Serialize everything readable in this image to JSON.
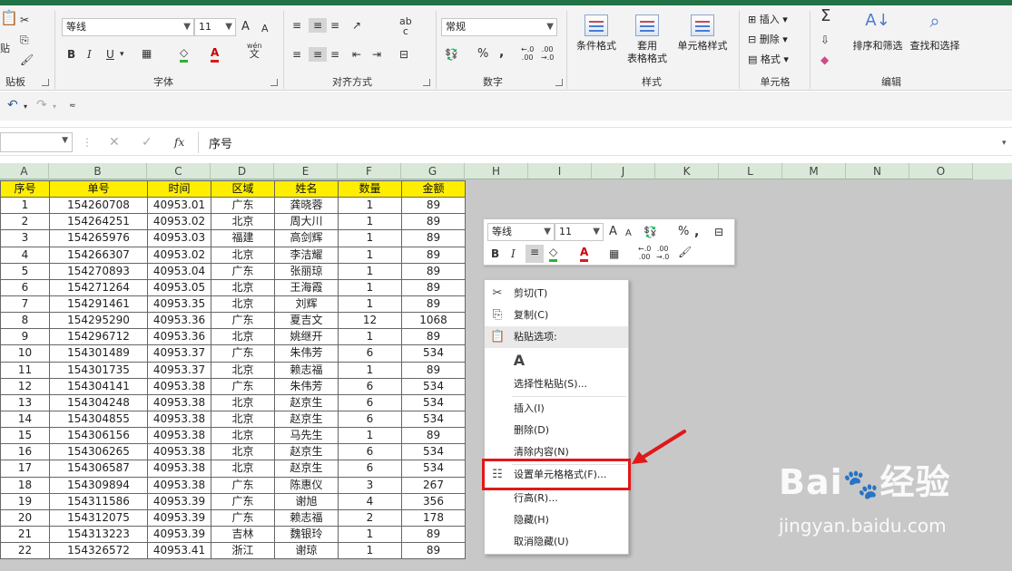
{
  "ribbon": {
    "clipboard": {
      "paste_label": "贴",
      "group_label": "贴板"
    },
    "font": {
      "name": "等线",
      "size": "11",
      "bold": "B",
      "italic": "I",
      "underline": "U",
      "grow": "A",
      "shrink": "A",
      "wen": "wén",
      "wen_char": "文",
      "group_label": "字体"
    },
    "align": {
      "group_label": "对齐方式",
      "wrap": "ab",
      "wrap_char": "c"
    },
    "number": {
      "format": "常规",
      "percent": "%",
      "comma": ",",
      "group_label": "数字"
    },
    "styles": {
      "cond": "条件格式",
      "table_1": "套用",
      "table_2": "表格格式",
      "cell": "单元格样式",
      "group_label": "样式"
    },
    "cells": {
      "insert": "插入",
      "delete": "删除",
      "format": "格式",
      "group_label": "单元格"
    },
    "editing": {
      "sum": "Σ",
      "sort": "排序和筛选",
      "find": "查找和选择",
      "group_label": "编辑"
    }
  },
  "formula_bar": {
    "content": "序号",
    "fx": "fx"
  },
  "columns": [
    "A",
    "B",
    "C",
    "D",
    "E",
    "F",
    "G",
    "H",
    "I",
    "J",
    "K",
    "L",
    "M",
    "N",
    "O"
  ],
  "headers": [
    "序号",
    "单号",
    "时间",
    "区域",
    "姓名",
    "数量",
    "金额"
  ],
  "rows": [
    [
      "1",
      "154260708",
      "40953.01",
      "广东",
      "龚晓蓉",
      "1",
      "89"
    ],
    [
      "2",
      "154264251",
      "40953.02",
      "北京",
      "周大川",
      "1",
      "89"
    ],
    [
      "3",
      "154265976",
      "40953.03",
      "福建",
      "高剑辉",
      "1",
      "89"
    ],
    [
      "4",
      "154266307",
      "40953.02",
      "北京",
      "李洁耀",
      "1",
      "89"
    ],
    [
      "5",
      "154270893",
      "40953.04",
      "广东",
      "张丽琼",
      "1",
      "89"
    ],
    [
      "6",
      "154271264",
      "40953.05",
      "北京",
      "王海霞",
      "1",
      "89"
    ],
    [
      "7",
      "154291461",
      "40953.35",
      "北京",
      "刘辉",
      "1",
      "89"
    ],
    [
      "8",
      "154295290",
      "40953.36",
      "广东",
      "夏吉文",
      "12",
      "1068"
    ],
    [
      "9",
      "154296712",
      "40953.36",
      "北京",
      "姚继开",
      "1",
      "89"
    ],
    [
      "10",
      "154301489",
      "40953.37",
      "广东",
      "朱伟芳",
      "6",
      "534"
    ],
    [
      "11",
      "154301735",
      "40953.37",
      "北京",
      "赖志福",
      "1",
      "89"
    ],
    [
      "12",
      "154304141",
      "40953.38",
      "广东",
      "朱伟芳",
      "6",
      "534"
    ],
    [
      "13",
      "154304248",
      "40953.38",
      "北京",
      "赵京生",
      "6",
      "534"
    ],
    [
      "14",
      "154304855",
      "40953.38",
      "北京",
      "赵京生",
      "6",
      "534"
    ],
    [
      "15",
      "154306156",
      "40953.38",
      "北京",
      "马先生",
      "1",
      "89"
    ],
    [
      "16",
      "154306265",
      "40953.38",
      "北京",
      "赵京生",
      "6",
      "534"
    ],
    [
      "17",
      "154306587",
      "40953.38",
      "北京",
      "赵京生",
      "6",
      "534"
    ],
    [
      "18",
      "154309894",
      "40953.38",
      "广东",
      "陈惠仪",
      "3",
      "267"
    ],
    [
      "19",
      "154311586",
      "40953.39",
      "广东",
      "谢旭",
      "4",
      "356"
    ],
    [
      "20",
      "154312075",
      "40953.39",
      "广东",
      "赖志福",
      "2",
      "178"
    ],
    [
      "21",
      "154313223",
      "40953.39",
      "吉林",
      "魏银玲",
      "1",
      "89"
    ],
    [
      "22",
      "154326572",
      "40953.41",
      "浙江",
      "谢琼",
      "1",
      "89"
    ]
  ],
  "mini_toolbar": {
    "font": "等线",
    "size": "11",
    "grow": "A",
    "shrink": "A",
    "percent": "%",
    "bold": "B",
    "italic": "I",
    "color_a": "A"
  },
  "context_menu": [
    {
      "label": "剪切(T)",
      "icon": "✂"
    },
    {
      "label": "复制(C)",
      "icon": "⎘"
    },
    {
      "label": "粘贴选项:",
      "icon": "📋"
    },
    {
      "label": "",
      "icon": "A"
    },
    {
      "label": "选择性粘贴(S)...",
      "icon": ""
    },
    {
      "label": "插入(I)",
      "icon": ""
    },
    {
      "label": "删除(D)",
      "icon": ""
    },
    {
      "label": "清除内容(N)",
      "icon": ""
    },
    {
      "label": "设置单元格格式(F)...",
      "icon": "☷"
    },
    {
      "label": "行高(R)...",
      "icon": ""
    },
    {
      "label": "隐藏(H)",
      "icon": ""
    },
    {
      "label": "取消隐藏(U)",
      "icon": ""
    }
  ],
  "watermark": {
    "brand": "Bai",
    "brand_tail": "经验",
    "url": "jingyan.baidu.com"
  },
  "colors": {
    "excel_green": "#217346",
    "header_yellow": "#ffee00",
    "highlight_red": "#e01818"
  }
}
